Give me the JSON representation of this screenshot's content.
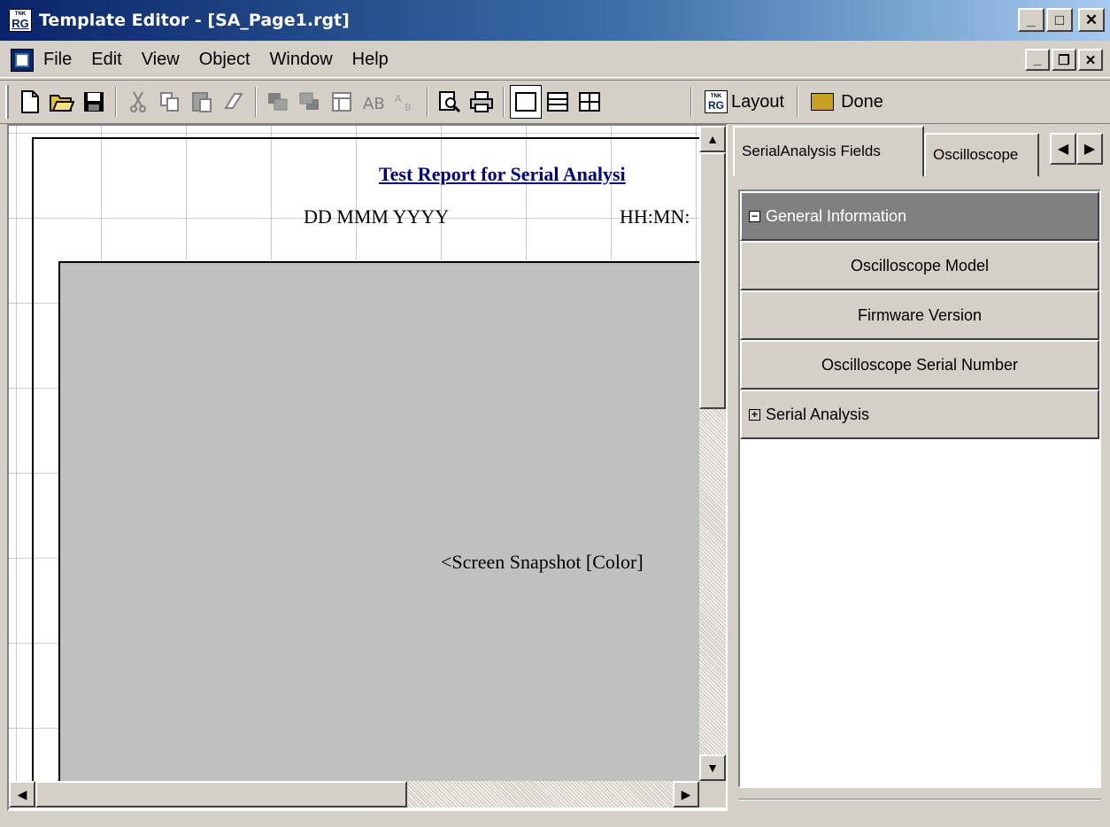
{
  "window": {
    "title": "Template Editor - [SA_Page1.rgt]",
    "icon": "rg-app-icon",
    "icon_text_small": "TNK",
    "icon_text_large": "RG",
    "controls": {
      "minimize": "_",
      "maximize": "□",
      "close": "✕"
    }
  },
  "menu": {
    "items": [
      "File",
      "Edit",
      "View",
      "Object",
      "Window",
      "Help"
    ],
    "doc_controls": {
      "minimize": "_",
      "restore": "❐",
      "close": "✕"
    }
  },
  "toolbar": {
    "buttons": [
      {
        "icon": "new-file-icon",
        "glyph": "🗋"
      },
      {
        "icon": "open-folder-icon",
        "glyph": "📂"
      },
      {
        "icon": "save-icon",
        "glyph": "💾"
      },
      {
        "icon": "cut-icon",
        "glyph": "✂"
      },
      {
        "icon": "copy-icon",
        "glyph": "⎘"
      },
      {
        "icon": "paste-icon",
        "glyph": "📋"
      },
      {
        "icon": "eraser-icon",
        "glyph": "⌫"
      },
      {
        "icon": "bring-front-icon",
        "glyph": "▣"
      },
      {
        "icon": "send-back-icon",
        "glyph": "▣"
      },
      {
        "icon": "properties-icon",
        "glyph": "▤"
      },
      {
        "icon": "text-field-icon",
        "glyph": "A"
      },
      {
        "icon": "barcode-icon",
        "glyph": "B"
      },
      {
        "icon": "print-preview-icon",
        "glyph": "🔍"
      },
      {
        "icon": "print-icon",
        "glyph": "🖶"
      }
    ],
    "layout_icons": [
      "single-layout-icon",
      "horizontal-split-icon",
      "quad-layout-icon"
    ],
    "layout_label": "Layout",
    "done_label": "Done"
  },
  "document": {
    "report_title": "Test Report for Serial Analysi",
    "date_placeholder": "DD MMM YYYY",
    "time_placeholder": "HH:MN:",
    "snapshot_label": "<Screen Snapshot [Color]"
  },
  "panel": {
    "tabs": [
      "SerialAnalysis Fields",
      "Oscilloscope"
    ],
    "tree": {
      "group1": {
        "label": "General Information",
        "expanded": true,
        "children": [
          "Oscilloscope Model",
          "Firmware Version",
          "Oscilloscope Serial Number"
        ]
      },
      "group2": {
        "label": "Serial Analysis",
        "expanded": false
      }
    }
  },
  "colors": {
    "titlebar_start": "#0a246a",
    "titlebar_end": "#a6caf0",
    "report_title": "#000080",
    "snapshot_fill": "#c0c0c0",
    "tree_header": "#808080"
  }
}
